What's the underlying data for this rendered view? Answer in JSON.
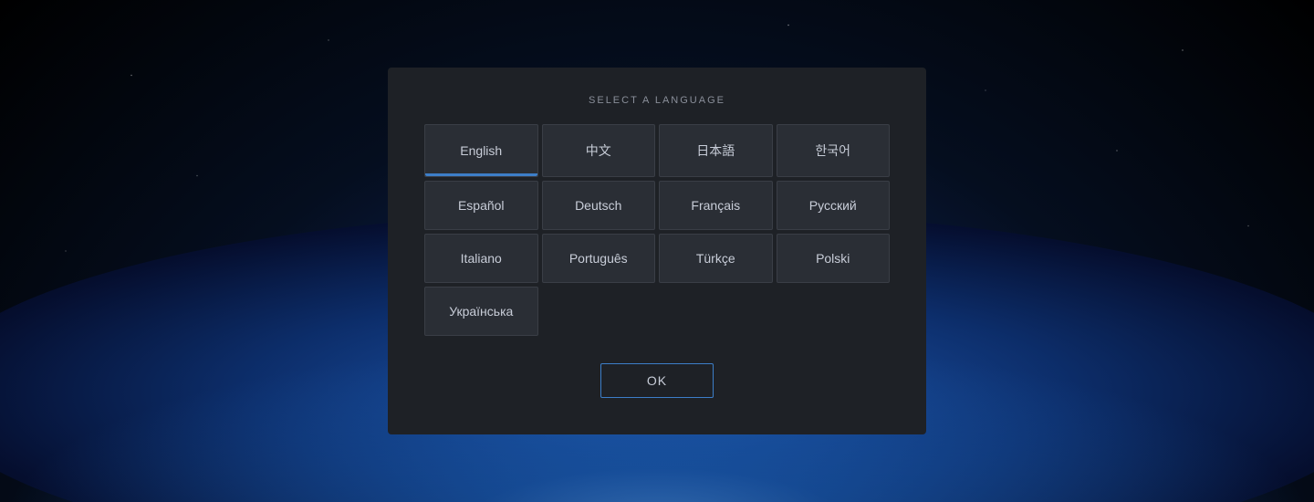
{
  "dialog": {
    "title": "SELECT A LANGUAGE",
    "ok_label": "OK"
  },
  "languages": [
    {
      "id": "english",
      "label": "English",
      "selected": true
    },
    {
      "id": "chinese",
      "label": "中文",
      "selected": false
    },
    {
      "id": "japanese",
      "label": "日本語",
      "selected": false
    },
    {
      "id": "korean",
      "label": "한국어",
      "selected": false
    },
    {
      "id": "spanish",
      "label": "Español",
      "selected": false
    },
    {
      "id": "german",
      "label": "Deutsch",
      "selected": false
    },
    {
      "id": "french",
      "label": "Français",
      "selected": false
    },
    {
      "id": "russian",
      "label": "Русский",
      "selected": false
    },
    {
      "id": "italian",
      "label": "Italiano",
      "selected": false
    },
    {
      "id": "portuguese",
      "label": "Português",
      "selected": false
    },
    {
      "id": "turkish",
      "label": "Türkçe",
      "selected": false
    },
    {
      "id": "polish",
      "label": "Polski",
      "selected": false
    },
    {
      "id": "ukrainian",
      "label": "Українська",
      "selected": false
    }
  ]
}
